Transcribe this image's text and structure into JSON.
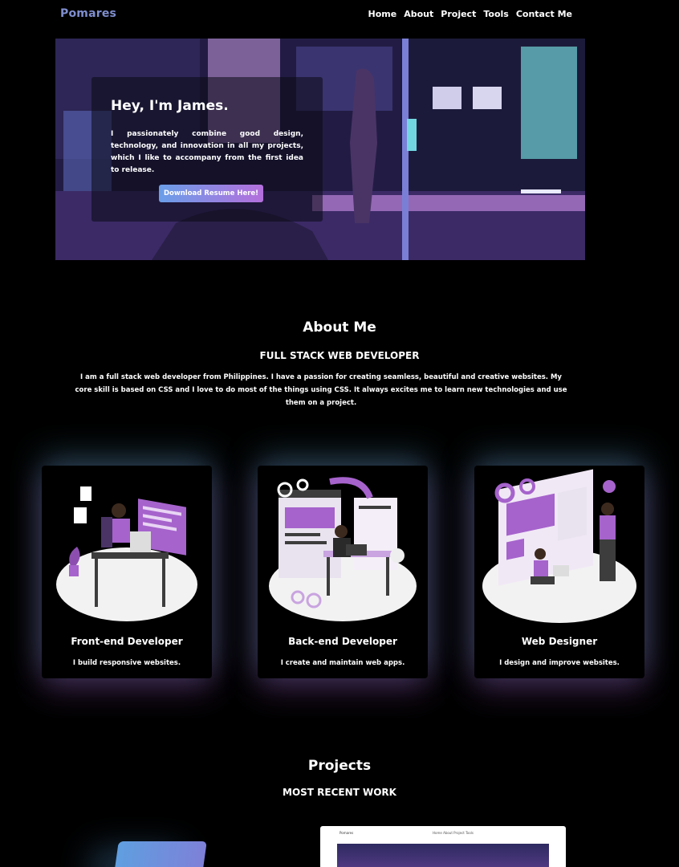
{
  "nav": {
    "logo": "Pomares",
    "links": [
      "Home",
      "About",
      "Project",
      "Tools",
      "Contact Me"
    ]
  },
  "hero": {
    "title": "Hey, I'm James.",
    "text": "I passionately combine good design, technology, and innovation in all my projects, which I like to accompany from the first idea to release.",
    "button": "Download Resume Here!"
  },
  "about": {
    "title": "About Me",
    "subtitle": "FULL STACK WEB DEVELOPER",
    "text": "I am a full stack web developer from Philippines. I have a passion for creating seamless, beautiful and creative websites. My core skill is based on CSS and I love to do most of the things using CSS. It always excites me to learn new technologies and use them on a project."
  },
  "services": [
    {
      "title": "Front-end Developer",
      "desc": "I build responsive websites."
    },
    {
      "title": "Back-end Developer",
      "desc": "I create and maintain web apps."
    },
    {
      "title": "Web Designer",
      "desc": "I design and improve websites."
    }
  ],
  "projects": {
    "title": "Projects",
    "subtitle": "MOST RECENT WORK",
    "thumb_logo": "Pomares",
    "thumb_nav": "Home  About  Project  Tools"
  },
  "colors": {
    "accent_purple": "#a663cc",
    "accent_blue": "#6a9ee8",
    "logo": "#7f8ecf"
  }
}
